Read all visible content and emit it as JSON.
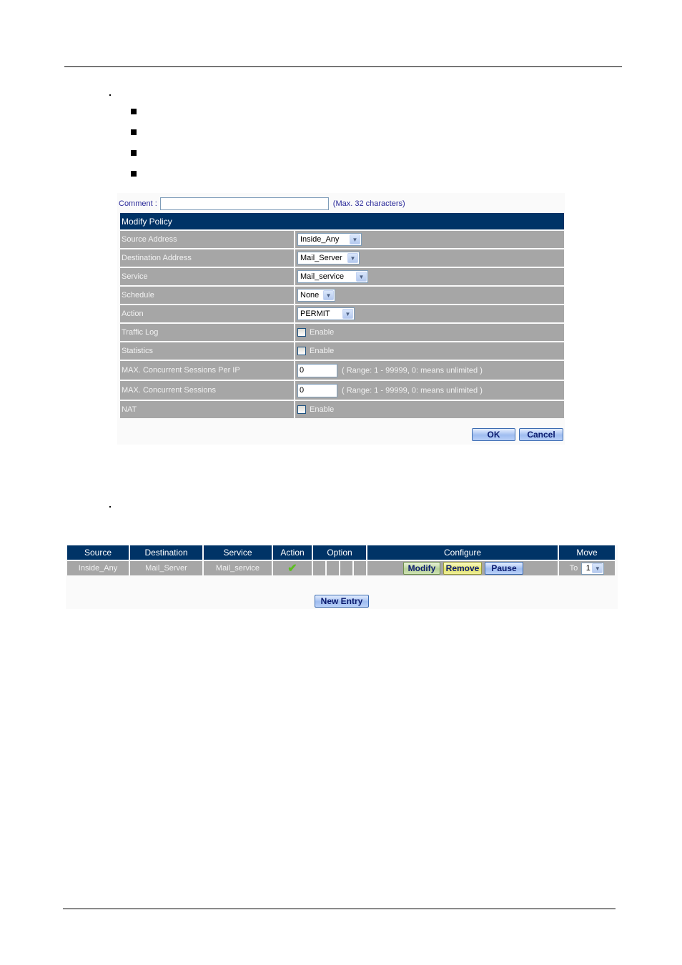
{
  "comment": {
    "label": "Comment :",
    "value": "",
    "hint": "(Max. 32 characters)"
  },
  "policy_form": {
    "title": "Modify Policy",
    "rows": [
      {
        "label": "Source Address",
        "type": "select",
        "value": "Inside_Any"
      },
      {
        "label": "Destination Address",
        "type": "select",
        "value": "Mail_Server"
      },
      {
        "label": "Service",
        "type": "select",
        "value": "Mail_service"
      },
      {
        "label": "Schedule",
        "type": "select",
        "value": "None"
      },
      {
        "label": "Action",
        "type": "select",
        "value": "PERMIT"
      },
      {
        "label": "Traffic Log",
        "type": "checkbox",
        "checked": false,
        "text": "Enable"
      },
      {
        "label": "Statistics",
        "type": "checkbox",
        "checked": false,
        "text": "Enable"
      },
      {
        "label": "MAX. Concurrent Sessions Per IP",
        "type": "number",
        "value": "0",
        "hint": "( Range: 1 - 99999, 0: means unlimited )"
      },
      {
        "label": "MAX. Concurrent Sessions",
        "type": "number",
        "value": "0",
        "hint": "( Range: 1 - 99999, 0: means unlimited )"
      },
      {
        "label": "NAT",
        "type": "checkbox",
        "checked": false,
        "text": "Enable"
      }
    ],
    "ok_label": "OK",
    "cancel_label": "Cancel"
  },
  "policy_list": {
    "headers": {
      "source": "Source",
      "destination": "Destination",
      "service": "Service",
      "action": "Action",
      "option": "Option",
      "configure": "Configure",
      "move": "Move"
    },
    "rows": [
      {
        "source": "Inside_Any",
        "destination": "Mail_Server",
        "service": "Mail_service",
        "action_icon": "✔",
        "modify_label": "Modify",
        "remove_label": "Remove",
        "pause_label": "Pause",
        "move_to_label": "To",
        "move_value": "1"
      }
    ],
    "new_entry_label": "New  Entry"
  },
  "icons": {
    "dropdown_arrow": "▼"
  }
}
